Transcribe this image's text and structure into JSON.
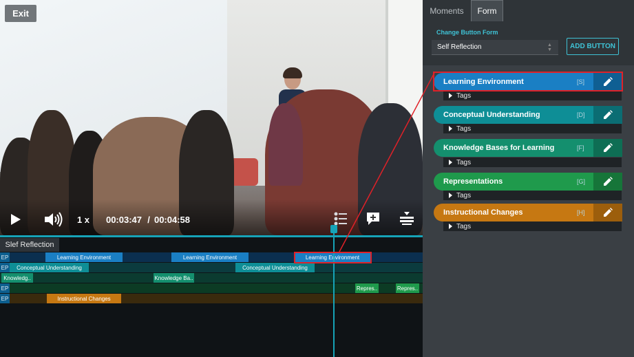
{
  "player": {
    "exit_label": "Exit",
    "speed": "1 x",
    "current_time": "00:03:47",
    "separator": "/",
    "total_time": "00:04:58"
  },
  "timeline": {
    "tab_label": "Slef Reflection",
    "ep_label": "EP",
    "segments": [
      {
        "row": 0,
        "label": "Learning Environment",
        "color": "#1a7fc4"
      },
      {
        "row": 0,
        "label": "Learning Environment",
        "color": "#1a7fc4"
      },
      {
        "row": 0,
        "label": "Learning Environment",
        "color": "#1a7fc4"
      },
      {
        "row": 1,
        "label": "Conceptual Understanding",
        "color": "#0e8e96"
      },
      {
        "row": 1,
        "label": "Conceptual Understanding",
        "color": "#0e8e96"
      },
      {
        "row": 2,
        "label": "Knowledg..",
        "color": "#148f6e"
      },
      {
        "row": 2,
        "label": "Knowledge Ba..",
        "color": "#148f6e"
      },
      {
        "row": 3,
        "label": "Repres..",
        "color": "#1f9a4c"
      },
      {
        "row": 3,
        "label": "Repres..",
        "color": "#1f9a4c"
      },
      {
        "row": 4,
        "label": "Instructional Changes",
        "color": "#c67812"
      }
    ]
  },
  "panel": {
    "tabs": [
      {
        "label": "Moments"
      },
      {
        "label": "Form"
      }
    ],
    "change_form_label": "Change Button Form",
    "form_select_value": "Self Reflection",
    "add_button_label": "ADD BUTTON",
    "tags_label": "Tags",
    "categories": [
      {
        "label": "Learning Environment",
        "key": "[S]",
        "color": "#1a7fc4",
        "edit_bg": "#0f5f93"
      },
      {
        "label": "Conceptual Understanding",
        "key": "[D]",
        "color": "#0e8e96",
        "edit_bg": "#0b6d73"
      },
      {
        "label": "Knowledge Bases for Learning",
        "key": "[F]",
        "color": "#148f6e",
        "edit_bg": "#0e6e54"
      },
      {
        "label": "Representations",
        "key": "[G]",
        "color": "#1f9a4c",
        "edit_bg": "#167539"
      },
      {
        "label": "Instructional Changes",
        "key": "[H]",
        "color": "#c67812",
        "edit_bg": "#9c5e0c"
      }
    ]
  },
  "colors": {
    "accent": "#16a3b8",
    "highlight": "#e02128"
  }
}
